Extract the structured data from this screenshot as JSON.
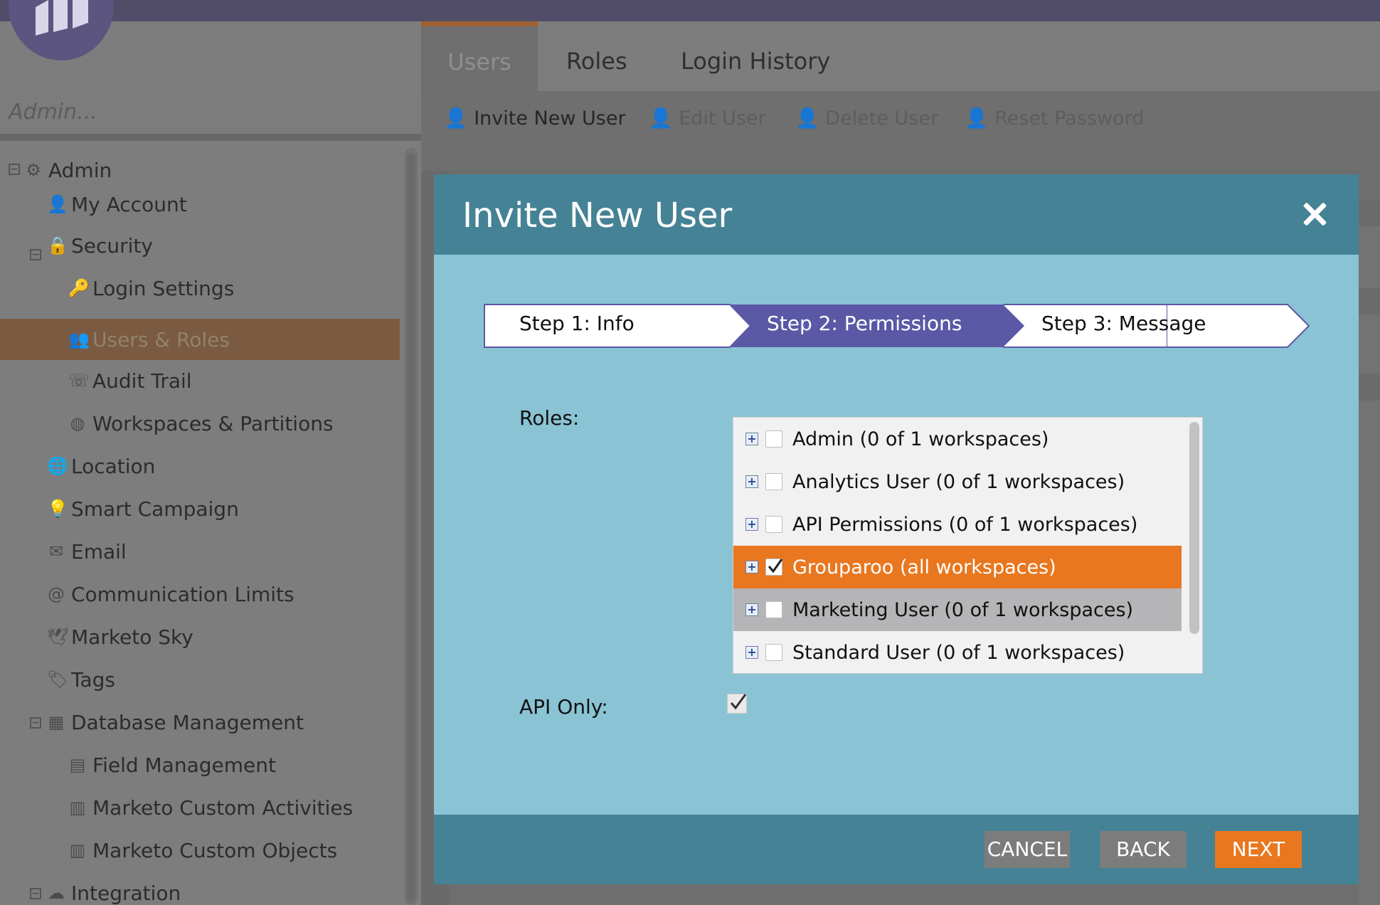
{
  "left_panel": {
    "search_placeholder": "Admin...",
    "tree": [
      {
        "label": "Admin",
        "icon": "gear-icon"
      },
      {
        "label": "My Account",
        "icon": "user-icon"
      },
      {
        "label": "Security",
        "icon": "lock-icon"
      },
      {
        "label": "Login Settings",
        "icon": "key-icon"
      },
      {
        "label": "Users & Roles",
        "icon": "users-icon",
        "selected": true
      },
      {
        "label": "Audit Trail",
        "icon": "audit-icon"
      },
      {
        "label": "Workspaces & Partitions",
        "icon": "globe-icon"
      },
      {
        "label": "Location",
        "icon": "location-globe-icon"
      },
      {
        "label": "Smart Campaign",
        "icon": "lightbulb-icon"
      },
      {
        "label": "Email",
        "icon": "email-icon"
      },
      {
        "label": "Communication Limits",
        "icon": "at-sign-icon"
      },
      {
        "label": "Marketo Sky",
        "icon": "bird-icon"
      },
      {
        "label": "Tags",
        "icon": "tag-icon"
      },
      {
        "label": "Database Management",
        "icon": "database-icon"
      },
      {
        "label": "Field Management",
        "icon": "field-icon"
      },
      {
        "label": "Marketo Custom Activities",
        "icon": "activities-icon"
      },
      {
        "label": "Marketo Custom Objects",
        "icon": "objects-icon"
      },
      {
        "label": "Integration",
        "icon": "cloud-icon"
      }
    ]
  },
  "tabs": [
    {
      "label": "Users",
      "active": true
    },
    {
      "label": "Roles"
    },
    {
      "label": "Login History"
    }
  ],
  "toolbar": {
    "invite": "Invite New User",
    "edit": "Edit User",
    "delete": "Delete User",
    "reset": "Reset Password"
  },
  "modal": {
    "title": "Invite New User",
    "steps": [
      {
        "label": "Step 1: Info",
        "state": "done"
      },
      {
        "label": "Step 2: Permissions",
        "state": "active"
      },
      {
        "label": "Step 3: Message",
        "state": "pending"
      }
    ],
    "roles_label": "Roles:",
    "roles": [
      {
        "label": "Admin (0 of 1 workspaces)",
        "checked": false
      },
      {
        "label": "Analytics User (0 of 1 workspaces)",
        "checked": false
      },
      {
        "label": "API Permissions (0 of 1 workspaces)",
        "checked": false
      },
      {
        "label": "Grouparoo (all workspaces)",
        "checked": true,
        "selected": true
      },
      {
        "label": "Marketing User (0 of 1 workspaces)",
        "checked": false,
        "hover": true
      },
      {
        "label": "Standard User (0 of 1 workspaces)",
        "checked": false
      }
    ],
    "api_only_label": "API Only:",
    "api_only_checked": true,
    "buttons": {
      "cancel": "CANCEL",
      "back": "BACK",
      "next": "NEXT"
    }
  },
  "colors": {
    "modal_header": "#458295",
    "modal_body": "#8ac3d4",
    "step_active": "#5b58a6",
    "accent_orange": "#e8771f"
  }
}
